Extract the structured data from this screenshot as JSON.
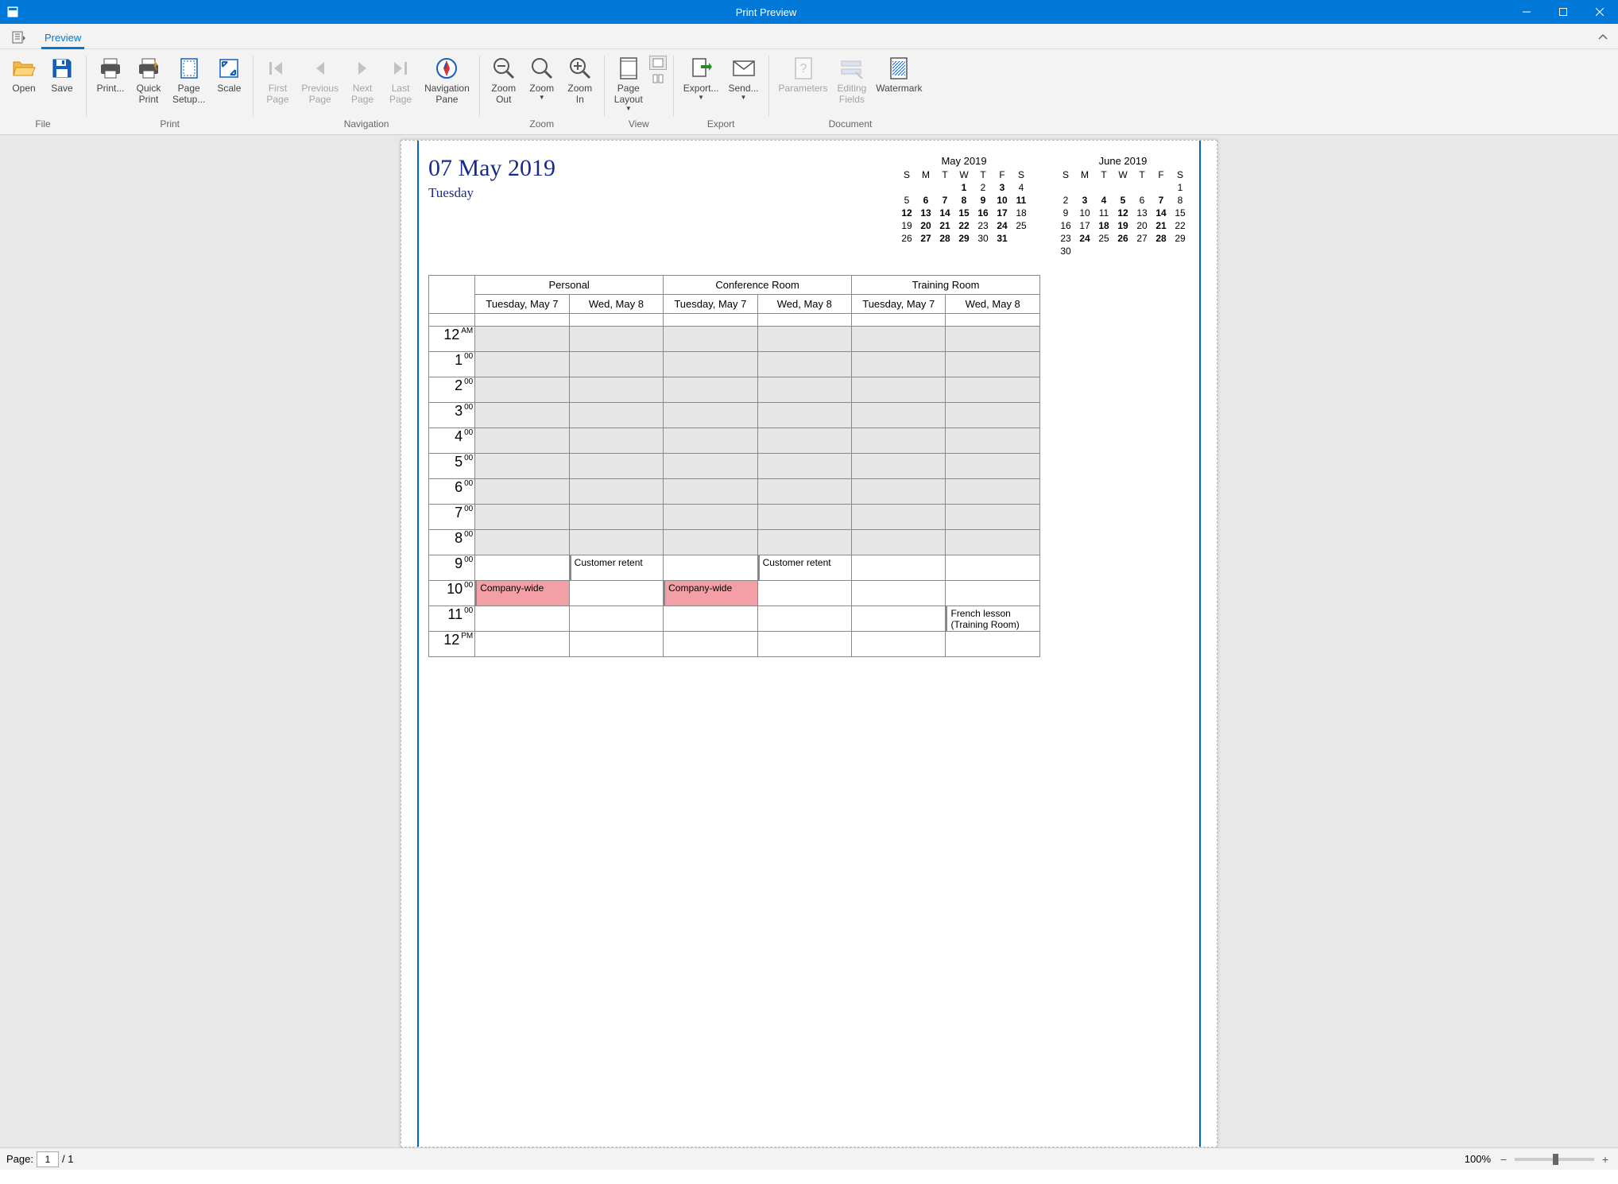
{
  "window": {
    "title": "Print Preview"
  },
  "ribbon": {
    "tabs": {
      "preview": "Preview"
    },
    "groups": {
      "file": {
        "label": "File",
        "open": "Open",
        "save": "Save"
      },
      "print": {
        "label": "Print",
        "print": "Print...",
        "quick_print": "Quick\nPrint",
        "page_setup": "Page\nSetup...",
        "scale": "Scale"
      },
      "navigation": {
        "label": "Navigation",
        "first": "First\nPage",
        "prev": "Previous\nPage",
        "next": "Next\nPage",
        "last": "Last\nPage",
        "nav_pane": "Navigation\nPane"
      },
      "zoom": {
        "label": "Zoom",
        "out": "Zoom\nOut",
        "zoom": "Zoom",
        "in": "Zoom\nIn"
      },
      "view": {
        "label": "View",
        "page_layout": "Page\nLayout"
      },
      "export": {
        "label": "Export",
        "export": "Export...",
        "send": "Send..."
      },
      "document": {
        "label": "Document",
        "parameters": "Parameters",
        "editing_fields": "Editing\nFields",
        "watermark": "Watermark"
      }
    }
  },
  "page": {
    "date_title": "07 May 2019",
    "day_of_week": "Tuesday",
    "mini_calendars": [
      {
        "title": "May 2019",
        "dow": [
          "S",
          "M",
          "T",
          "W",
          "T",
          "F",
          "S"
        ],
        "weeks": [
          [
            null,
            null,
            null,
            {
              "v": "1",
              "b": true
            },
            {
              "v": "2"
            },
            {
              "v": "3",
              "b": true
            },
            {
              "v": "4"
            }
          ],
          [
            {
              "v": "5"
            },
            {
              "v": "6",
              "b": true
            },
            {
              "v": "7",
              "b": true
            },
            {
              "v": "8",
              "b": true
            },
            {
              "v": "9",
              "b": true
            },
            {
              "v": "10",
              "b": true
            },
            {
              "v": "11",
              "b": true
            }
          ],
          [
            {
              "v": "12",
              "b": true
            },
            {
              "v": "13",
              "b": true
            },
            {
              "v": "14",
              "b": true
            },
            {
              "v": "15",
              "b": true
            },
            {
              "v": "16",
              "b": true
            },
            {
              "v": "17",
              "b": true
            },
            {
              "v": "18"
            }
          ],
          [
            {
              "v": "19"
            },
            {
              "v": "20",
              "b": true
            },
            {
              "v": "21",
              "b": true
            },
            {
              "v": "22",
              "b": true
            },
            {
              "v": "23"
            },
            {
              "v": "24",
              "b": true
            },
            {
              "v": "25"
            }
          ],
          [
            {
              "v": "26"
            },
            {
              "v": "27",
              "b": true
            },
            {
              "v": "28",
              "b": true
            },
            {
              "v": "29",
              "b": true
            },
            {
              "v": "30"
            },
            {
              "v": "31",
              "b": true
            },
            null
          ]
        ]
      },
      {
        "title": "June 2019",
        "dow": [
          "S",
          "M",
          "T",
          "W",
          "T",
          "F",
          "S"
        ],
        "weeks": [
          [
            null,
            null,
            null,
            null,
            null,
            null,
            {
              "v": "1"
            }
          ],
          [
            {
              "v": "2"
            },
            {
              "v": "3",
              "b": true
            },
            {
              "v": "4",
              "b": true
            },
            {
              "v": "5",
              "b": true
            },
            {
              "v": "6"
            },
            {
              "v": "7",
              "b": true
            },
            {
              "v": "8"
            }
          ],
          [
            {
              "v": "9"
            },
            {
              "v": "10"
            },
            {
              "v": "11"
            },
            {
              "v": "12",
              "b": true
            },
            {
              "v": "13"
            },
            {
              "v": "14",
              "b": true
            },
            {
              "v": "15"
            }
          ],
          [
            {
              "v": "16"
            },
            {
              "v": "17"
            },
            {
              "v": "18",
              "b": true
            },
            {
              "v": "19",
              "b": true
            },
            {
              "v": "20"
            },
            {
              "v": "21",
              "b": true
            },
            {
              "v": "22"
            }
          ],
          [
            {
              "v": "23"
            },
            {
              "v": "24",
              "b": true
            },
            {
              "v": "25"
            },
            {
              "v": "26",
              "b": true
            },
            {
              "v": "27"
            },
            {
              "v": "28",
              "b": true
            },
            {
              "v": "29"
            }
          ],
          [
            {
              "v": "30"
            },
            null,
            null,
            null,
            null,
            null,
            null
          ]
        ]
      }
    ],
    "schedule": {
      "rooms": [
        "Personal",
        "Conference Room",
        "Training Room"
      ],
      "days": [
        "Tuesday, May 7",
        "Wed, May 8"
      ],
      "hours": [
        {
          "h": "12",
          "suffix": "AM"
        },
        {
          "h": "1",
          "suffix": "00"
        },
        {
          "h": "2",
          "suffix": "00"
        },
        {
          "h": "3",
          "suffix": "00"
        },
        {
          "h": "4",
          "suffix": "00"
        },
        {
          "h": "5",
          "suffix": "00"
        },
        {
          "h": "6",
          "suffix": "00"
        },
        {
          "h": "7",
          "suffix": "00"
        },
        {
          "h": "8",
          "suffix": "00"
        },
        {
          "h": "9",
          "suffix": "00"
        },
        {
          "h": "10",
          "suffix": "00"
        },
        {
          "h": "11",
          "suffix": "00"
        },
        {
          "h": "12",
          "suffix": "PM"
        }
      ],
      "events": {
        "9": {
          "1": {
            "text": "Customer retent",
            "cls": ""
          },
          "3": {
            "text": "Customer retent",
            "cls": ""
          }
        },
        "10": {
          "0": {
            "text": "Company-wide",
            "cls": "pink"
          },
          "2": {
            "text": "Company-wide",
            "cls": "pink"
          }
        },
        "11": {
          "5": {
            "text": "French lesson (Training Room)",
            "cls": "",
            "wrap": true
          }
        }
      }
    }
  },
  "status": {
    "page_label": "Page:",
    "page_current": "1",
    "page_total": "/ 1",
    "zoom": "100%"
  },
  "colors": {
    "accent": "#0078d7",
    "title_navy": "#1a2a8a",
    "event_pink": "#f2a0a6"
  }
}
